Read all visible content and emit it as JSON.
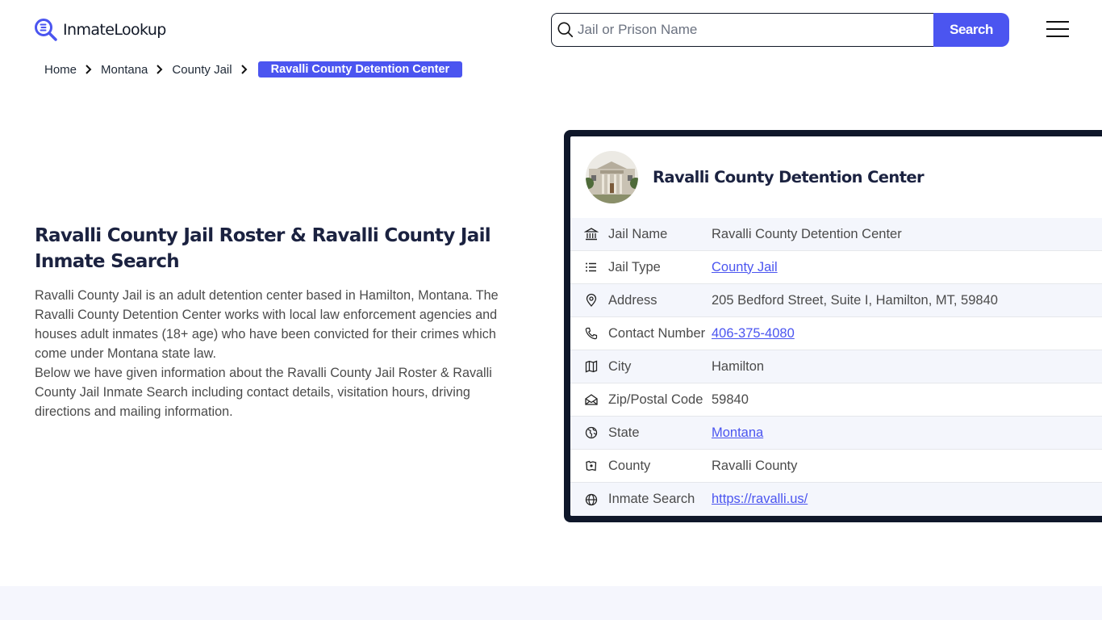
{
  "header": {
    "logo_text": "InmateLookup",
    "search": {
      "placeholder": "Jail or Prison Name",
      "value": "",
      "button_label": "Search"
    },
    "menu_icon": "hamburger-icon"
  },
  "colors": {
    "accent": "#4b55f0",
    "card_frame": "#0f172a",
    "title_text": "#1b2240",
    "row_alt_bg": "#f4f6fc",
    "footer_bg": "#f5f6fd"
  },
  "breadcrumb": {
    "items": [
      {
        "label": "Home"
      },
      {
        "label": "Montana"
      },
      {
        "label": "County Jail"
      }
    ],
    "current": "Ravalli County Detention Center"
  },
  "main": {
    "title": "Ravalli County Jail Roster & Ravalli County Jail Inmate Search",
    "paragraphs": [
      "Ravalli County Jail is an adult detention center based in Hamilton, Montana. The Ravalli County Detention Center works with local law enforcement agencies and houses adult inmates (18+ age) who have been convicted for their crimes which come under Montana state law.",
      "Below we have given information about the Ravalli County Jail Roster & Ravalli County Jail Inmate Search including contact details, visitation hours, driving directions and mailing information."
    ]
  },
  "card": {
    "title": "Ravalli County Detention Center",
    "image_alt": "courthouse-building-photo",
    "rows": [
      {
        "icon": "building-columns-icon",
        "label": "Jail Name",
        "value": "Ravalli County Detention Center",
        "is_link": false
      },
      {
        "icon": "list-icon",
        "label": "Jail Type",
        "value": "County Jail",
        "is_link": true
      },
      {
        "icon": "map-pin-icon",
        "label": "Address",
        "value": "205 Bedford Street, Suite I, Hamilton, MT, 59840",
        "is_link": false
      },
      {
        "icon": "phone-icon",
        "label": "Contact Number",
        "value": "406-375-4080",
        "is_link": true
      },
      {
        "icon": "map-icon",
        "label": "City",
        "value": "Hamilton",
        "is_link": false
      },
      {
        "icon": "envelope-open-icon",
        "label": "Zip/Postal Code",
        "value": "59840",
        "is_link": false
      },
      {
        "icon": "globe-region-icon",
        "label": "State",
        "value": "Montana",
        "is_link": true
      },
      {
        "icon": "county-map-icon",
        "label": "County",
        "value": "Ravalli County",
        "is_link": false
      },
      {
        "icon": "globe-icon",
        "label": "Inmate Search",
        "value": "https://ravalli.us/",
        "is_link": true
      }
    ]
  }
}
